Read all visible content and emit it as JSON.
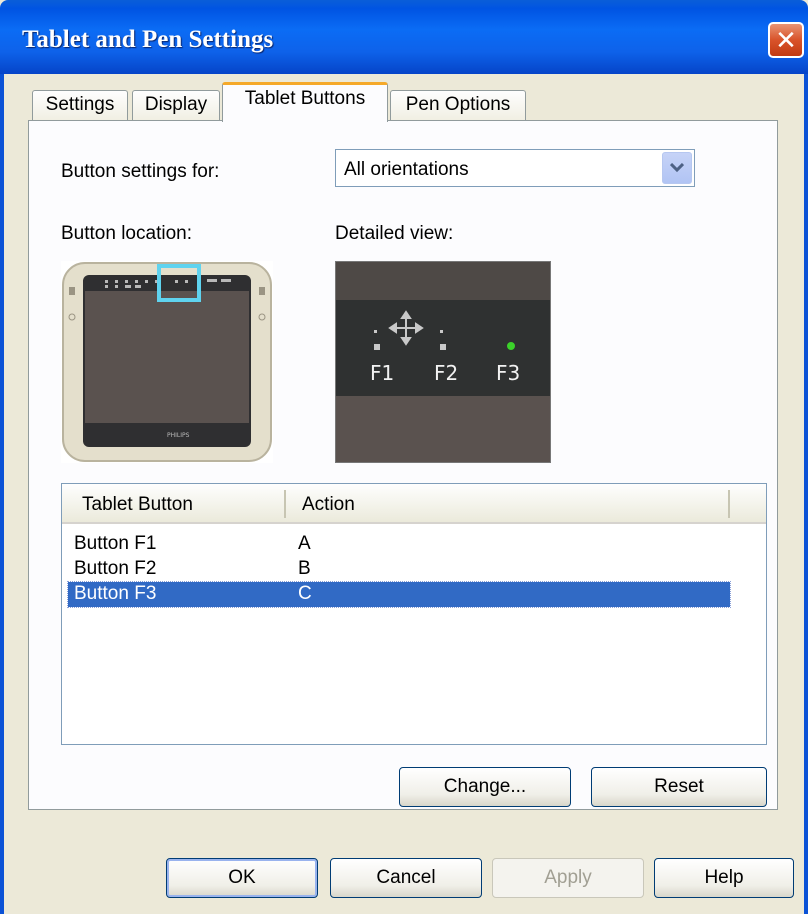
{
  "window": {
    "title": "Tablet and Pen Settings",
    "close_glyph": "✕"
  },
  "tabs": [
    {
      "label": "Settings"
    },
    {
      "label": "Display"
    },
    {
      "label": "Tablet Buttons",
      "active": true
    },
    {
      "label": "Pen Options"
    }
  ],
  "panel": {
    "settings_for_label": "Button settings for:",
    "orientation_select": {
      "value": "All orientations"
    },
    "location_label": "Button location:",
    "detail_label": "Detailed view:",
    "tablet_brand": "PHILIPS",
    "detail_keys": [
      "F1",
      "F2",
      "F3"
    ],
    "list": {
      "columns": [
        "Tablet Button",
        "Action"
      ],
      "rows": [
        {
          "button": "Button F1",
          "action": "A"
        },
        {
          "button": "Button F2",
          "action": "B"
        },
        {
          "button": "Button F3",
          "action": "C",
          "selected": true
        }
      ]
    },
    "change_button": "Change...",
    "reset_button": "Reset"
  },
  "footer": {
    "ok": "OK",
    "cancel": "Cancel",
    "apply": "Apply",
    "help": "Help"
  },
  "colors": {
    "titlebar": "#0b6cf5",
    "selection": "#316ac5",
    "highlight_box": "#5fd3ef",
    "led_green": "#3bd12a"
  }
}
